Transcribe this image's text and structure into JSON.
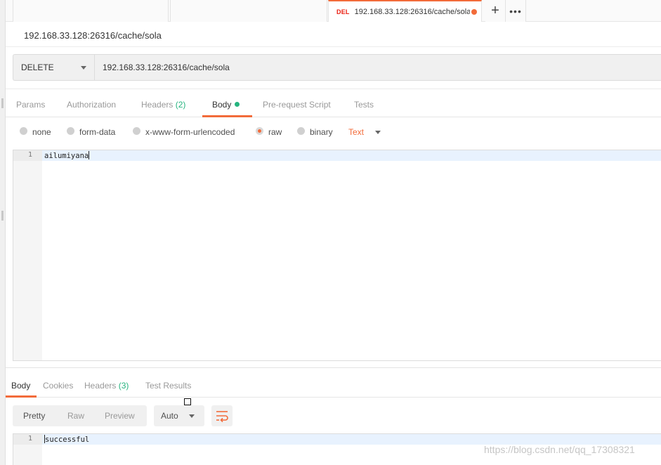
{
  "tabs": {
    "active": {
      "method": "DEL",
      "url": "192.168.33.128:26316/cache/sola",
      "has_unsaved": true
    },
    "new_tab_icon": "plus-icon",
    "more_icon": "more-dots-icon"
  },
  "request": {
    "name": "192.168.33.128:26316/cache/sola",
    "method": "DELETE",
    "url": "192.168.33.128:26316/cache/sola"
  },
  "request_tabs": [
    {
      "label": "Params"
    },
    {
      "label": "Authorization"
    },
    {
      "label": "Headers",
      "count": "(2)"
    },
    {
      "label": "Body",
      "active": true
    },
    {
      "label": "Pre-request Script"
    },
    {
      "label": "Tests"
    }
  ],
  "body_modes": [
    {
      "label": "none"
    },
    {
      "label": "form-data"
    },
    {
      "label": "x-www-form-urlencoded"
    },
    {
      "label": "raw",
      "selected": true
    },
    {
      "label": "binary"
    }
  ],
  "raw_type": "Text",
  "request_body": {
    "line_number": "1",
    "line": "ailumiyana"
  },
  "response_tabs": [
    {
      "label": "Body",
      "active": true
    },
    {
      "label": "Cookies"
    },
    {
      "label": "Headers",
      "count": "(3)"
    },
    {
      "label": "Test Results"
    }
  ],
  "response_view": {
    "modes": [
      "Pretty",
      "Raw",
      "Preview"
    ],
    "selected_mode": "Pretty",
    "format": "Auto",
    "wrap_icon": "wrap-lines-icon"
  },
  "response_body": {
    "line_number": "1",
    "line": "successful"
  },
  "watermark": "https://blog.csdn.net/qq_17308321",
  "colors": {
    "accent": "#f26b3a",
    "method_delete": "#eb2013",
    "count_green": "#26b47f"
  }
}
